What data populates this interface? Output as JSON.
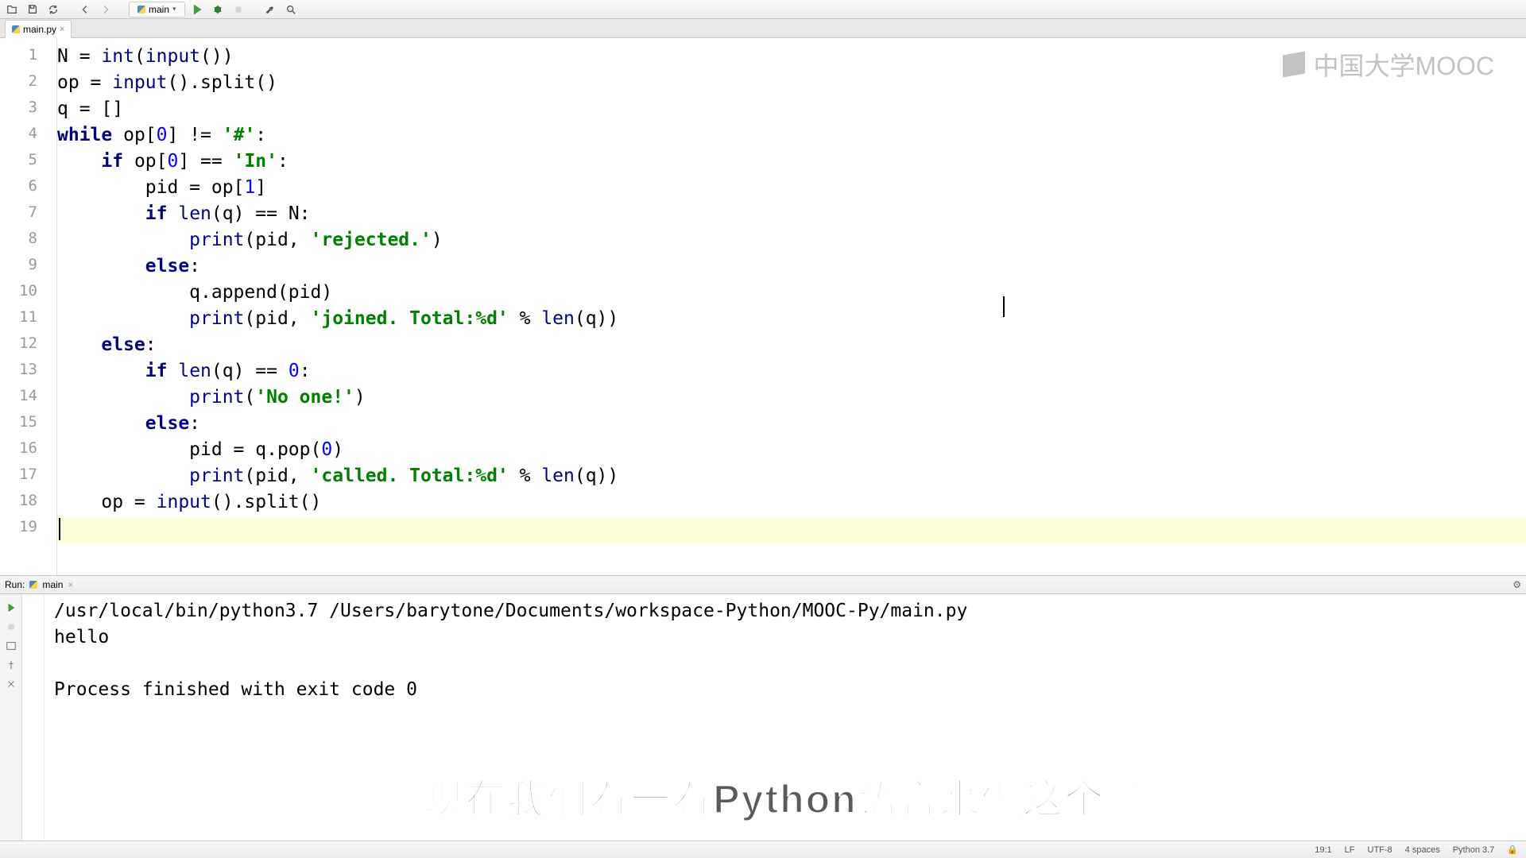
{
  "toolbar": {
    "run_config_label": "main"
  },
  "tabs": {
    "active_file": "main.py"
  },
  "editor": {
    "lines": [
      {
        "n": "1",
        "indent": "",
        "tokens": [
          [
            "",
            "N = "
          ],
          [
            "bi",
            "int"
          ],
          [
            "",
            "("
          ],
          [
            "bi",
            "input"
          ],
          [
            "",
            "())"
          ]
        ]
      },
      {
        "n": "2",
        "indent": "",
        "tokens": [
          [
            "",
            "op = "
          ],
          [
            "bi",
            "input"
          ],
          [
            "",
            "().split()"
          ]
        ]
      },
      {
        "n": "3",
        "indent": "",
        "tokens": [
          [
            "",
            "q = []"
          ]
        ]
      },
      {
        "n": "4",
        "indent": "",
        "tokens": [
          [
            "kw",
            "while"
          ],
          [
            "",
            " op["
          ],
          [
            "num",
            "0"
          ],
          [
            "",
            "] != "
          ],
          [
            "str",
            "'#'"
          ],
          [
            "",
            ":"
          ]
        ]
      },
      {
        "n": "5",
        "indent": "    ",
        "tokens": [
          [
            "kw",
            "if"
          ],
          [
            "",
            " op["
          ],
          [
            "num",
            "0"
          ],
          [
            "",
            "] == "
          ],
          [
            "str",
            "'In'"
          ],
          [
            "",
            ":"
          ]
        ]
      },
      {
        "n": "6",
        "indent": "        ",
        "tokens": [
          [
            "",
            "pid = op["
          ],
          [
            "num",
            "1"
          ],
          [
            "",
            "]"
          ]
        ]
      },
      {
        "n": "7",
        "indent": "        ",
        "tokens": [
          [
            "kw",
            "if"
          ],
          [
            "",
            " "
          ],
          [
            "bi",
            "len"
          ],
          [
            "",
            "(q) == N:"
          ]
        ]
      },
      {
        "n": "8",
        "indent": "            ",
        "tokens": [
          [
            "bi",
            "print"
          ],
          [
            "",
            "(pid, "
          ],
          [
            "str",
            "'rejected.'"
          ],
          [
            "",
            ")"
          ]
        ]
      },
      {
        "n": "9",
        "indent": "        ",
        "tokens": [
          [
            "kw",
            "else"
          ],
          [
            "",
            ":"
          ]
        ]
      },
      {
        "n": "10",
        "indent": "            ",
        "tokens": [
          [
            "",
            "q.append(pid)"
          ]
        ]
      },
      {
        "n": "11",
        "indent": "            ",
        "tokens": [
          [
            "bi",
            "print"
          ],
          [
            "",
            "(pid, "
          ],
          [
            "str",
            "'joined. Total:%d'"
          ],
          [
            "",
            " % "
          ],
          [
            "bi",
            "len"
          ],
          [
            "",
            "(q))"
          ]
        ]
      },
      {
        "n": "12",
        "indent": "    ",
        "tokens": [
          [
            "kw",
            "else"
          ],
          [
            "",
            ":"
          ]
        ]
      },
      {
        "n": "13",
        "indent": "        ",
        "tokens": [
          [
            "kw",
            "if"
          ],
          [
            "",
            " "
          ],
          [
            "bi",
            "len"
          ],
          [
            "",
            "(q) == "
          ],
          [
            "num",
            "0"
          ],
          [
            "",
            ":"
          ]
        ]
      },
      {
        "n": "14",
        "indent": "            ",
        "tokens": [
          [
            "bi",
            "print"
          ],
          [
            "",
            "("
          ],
          [
            "str",
            "'No one!'"
          ],
          [
            "",
            ")"
          ]
        ]
      },
      {
        "n": "15",
        "indent": "        ",
        "tokens": [
          [
            "kw",
            "else"
          ],
          [
            "",
            ":"
          ]
        ]
      },
      {
        "n": "16",
        "indent": "            ",
        "tokens": [
          [
            "",
            "pid = q.pop("
          ],
          [
            "num",
            "0"
          ],
          [
            "",
            ")"
          ]
        ]
      },
      {
        "n": "17",
        "indent": "            ",
        "tokens": [
          [
            "bi",
            "print"
          ],
          [
            "",
            "(pid, "
          ],
          [
            "str",
            "'called. Total:%d'"
          ],
          [
            "",
            " % "
          ],
          [
            "bi",
            "len"
          ],
          [
            "",
            "(q))"
          ]
        ]
      },
      {
        "n": "18",
        "indent": "    ",
        "tokens": [
          [
            "",
            "op = "
          ],
          [
            "bi",
            "input"
          ],
          [
            "",
            "().split()"
          ]
        ]
      },
      {
        "n": "19",
        "indent": "",
        "tokens": [],
        "highlight": true,
        "caret": true
      }
    ],
    "mooc_logo_text": "中国大学MOOC"
  },
  "run": {
    "header_label": "Run:",
    "config_name": "main",
    "console_lines": [
      "/usr/local/bin/python3.7 /Users/barytone/Documents/workspace-Python/MOOC-Py/main.py",
      "hello",
      "",
      "Process finished with exit code 0"
    ],
    "subtitle": "现在我们看一看Python语言来做这个题"
  },
  "status": {
    "pos": "19:1",
    "line_sep": "LF",
    "encoding": "UTF-8",
    "indent": "4 spaces",
    "python": "Python 3.7"
  }
}
